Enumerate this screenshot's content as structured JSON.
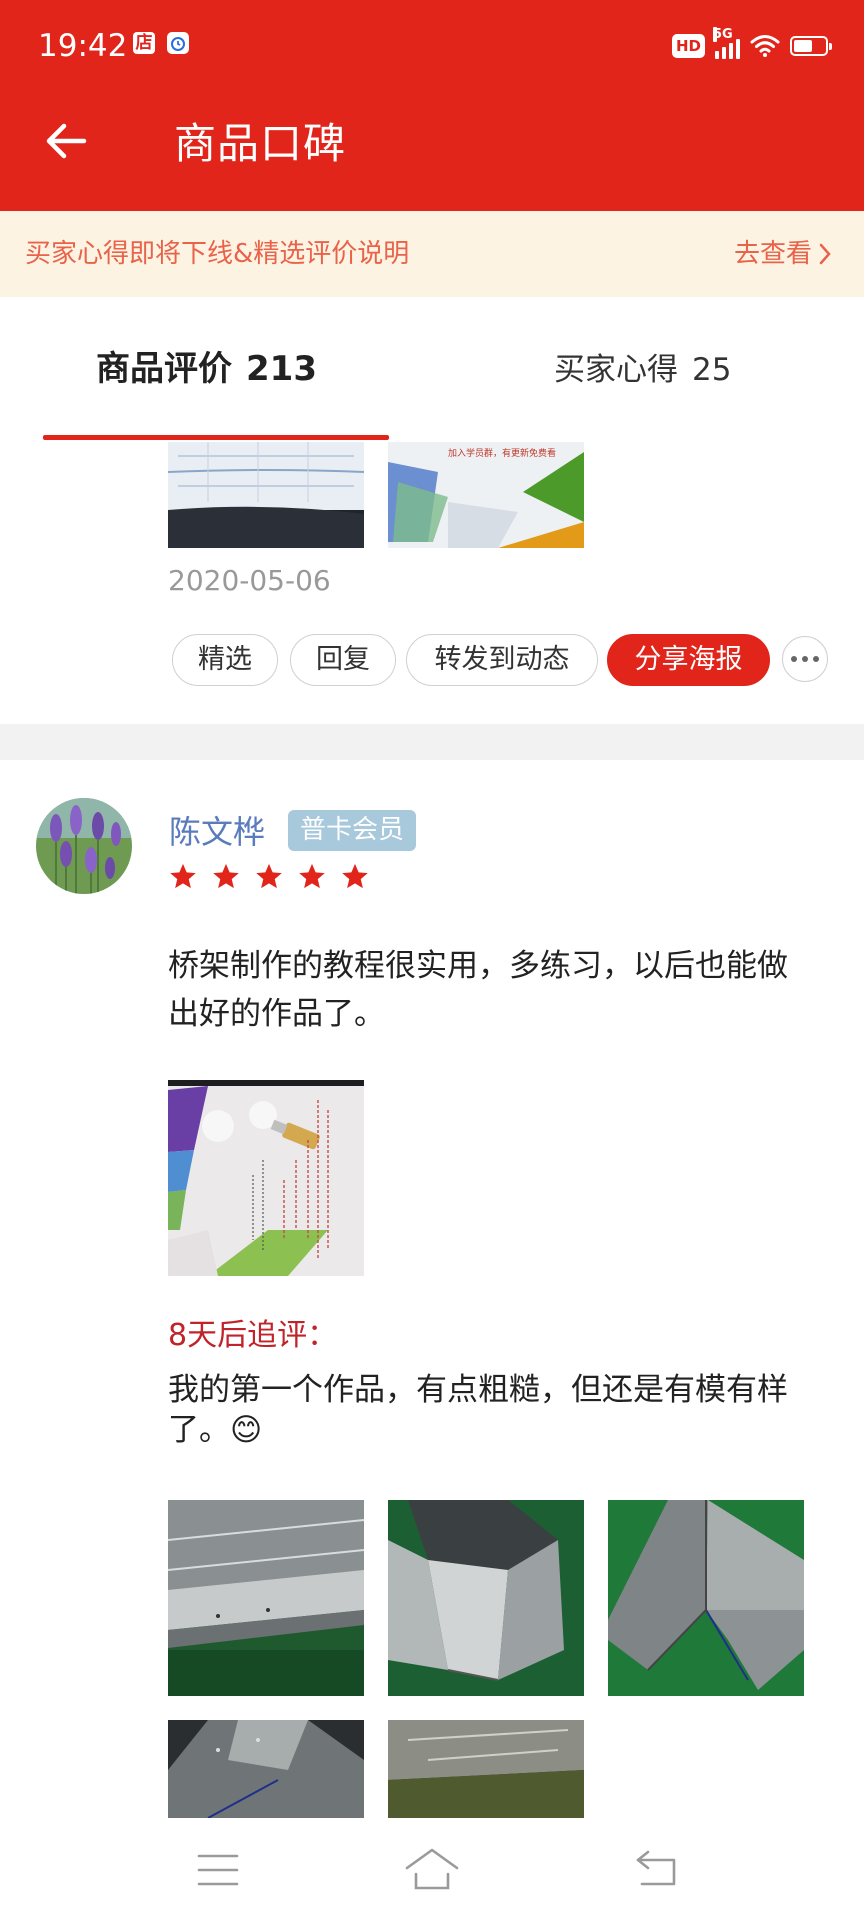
{
  "status_bar": {
    "time": "19:42",
    "left_icons": [
      "store-notification-icon",
      "alarm-notification-icon"
    ],
    "hd_label": "HD",
    "network": "5G",
    "battery_level": 0.6
  },
  "header": {
    "title": "商品口碑",
    "back_icon": "back-arrow-icon"
  },
  "notice": {
    "text": "买家心得即将下线&精选评价说明",
    "link_label": "去查看"
  },
  "tabs": [
    {
      "label": "商品评价",
      "count": "213",
      "active": true
    },
    {
      "label": "买家心得",
      "count": "25",
      "active": false
    }
  ],
  "previous_review": {
    "date": "2020-05-06",
    "actions": [
      "精选",
      "回复",
      "转发到动态",
      "分享海报"
    ],
    "more_icon": "more-dots-icon"
  },
  "review": {
    "reviewer_name": "陈文桦",
    "member_badge": "普卡会员",
    "rating": 5,
    "text": "桥架制作的教程很实用，多练习，以后也能做出好的作品了。",
    "followup_label": "8天后追评：",
    "followup_text": "我的第一个作品，有点粗糙，但还是有模有样了。😊"
  },
  "colors": {
    "brand_red": "#e1251b",
    "notice_bg": "#fdf3e3",
    "notice_text": "#e8634a",
    "name_blue": "#5a7cbc",
    "badge_blue": "#a8c8dc",
    "followup_red": "#c0232a"
  },
  "nav": {
    "icons": [
      "menu-icon",
      "home-icon",
      "back-icon"
    ]
  }
}
